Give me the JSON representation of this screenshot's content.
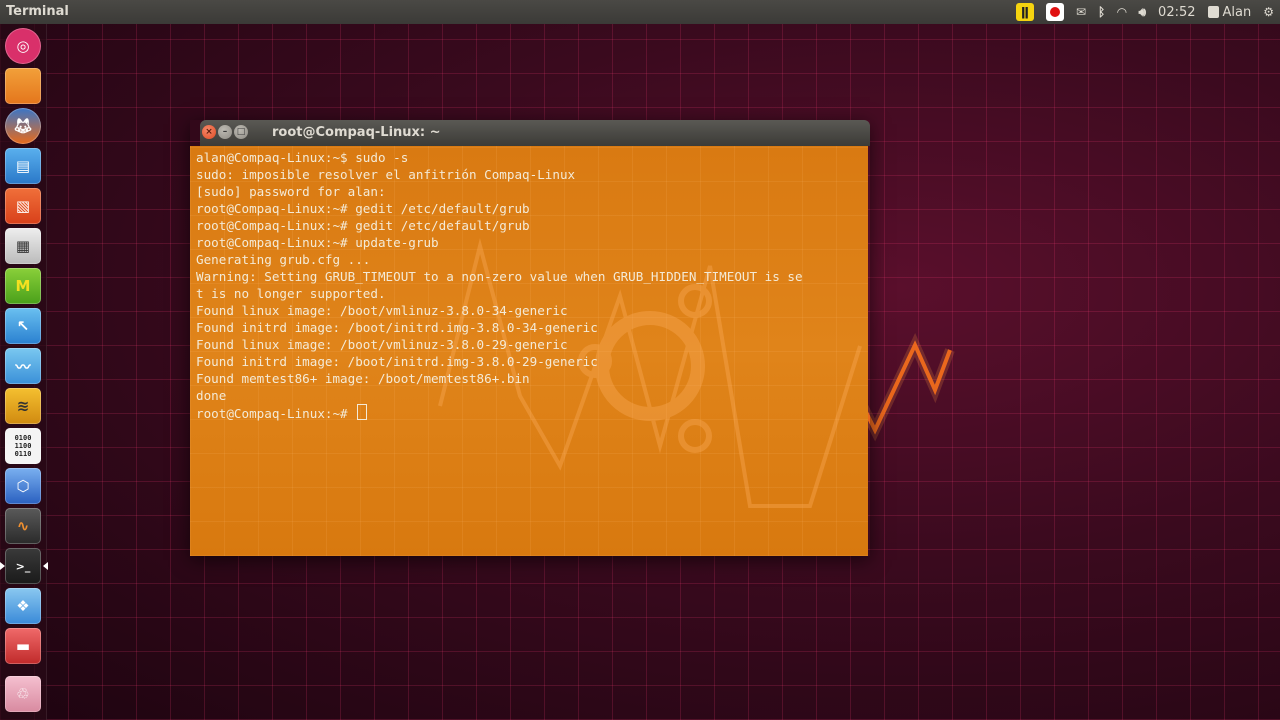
{
  "panel": {
    "app_title": "Terminal",
    "indicators": [
      "pause-indicator-icon",
      "record-indicator-icon",
      "mail-icon",
      "bluetooth-icon",
      "wifi-icon",
      "volume-icon"
    ],
    "clock": "02:52",
    "user": "Alan",
    "session_icon": "gear-icon"
  },
  "launcher": {
    "items": [
      "ubuntu-logo-icon",
      "files-icon",
      "firefox-icon",
      "document-icon",
      "presentation-icon",
      "calculator-icon",
      "market-icon",
      "drawing-icon",
      "monitor-icon",
      "video-editor-icon",
      "binary-icon",
      "cube-icon",
      "system-monitor-icon",
      "terminal-icon",
      "image-viewer-icon",
      "archive-icon",
      "trash-icon"
    ],
    "binary_label": "0100\n1100\n0110"
  },
  "terminal": {
    "window_title": "root@Compaq-Linux: ~",
    "close_glyph": "×",
    "min_glyph": "–",
    "max_glyph": "□",
    "lines": [
      "alan@Compaq-Linux:~$ sudo -s",
      "sudo: imposible resolver el anfitrión Compaq-Linux",
      "[sudo] password for alan:",
      "root@Compaq-Linux:~# gedit /etc/default/grub",
      "root@Compaq-Linux:~# gedit /etc/default/grub",
      "root@Compaq-Linux:~# update-grub",
      "Generating grub.cfg ...",
      "Warning: Setting GRUB_TIMEOUT to a non-zero value when GRUB_HIDDEN_TIMEOUT is se",
      "t is no longer supported.",
      "Found linux image: /boot/vmlinuz-3.8.0-34-generic",
      "Found initrd image: /boot/initrd.img-3.8.0-34-generic",
      "Found linux image: /boot/vmlinuz-3.8.0-29-generic",
      "Found initrd image: /boot/initrd.img-3.8.0-29-generic",
      "Found memtest86+ image: /boot/memtest86+.bin",
      "done",
      "root@Compaq-Linux:~# "
    ]
  },
  "colors": {
    "terminal_bg": "#de8118",
    "terminal_fg": "#f4ead6",
    "wallpaper": "#3a0a1e",
    "neon": "#ff7a1a"
  }
}
